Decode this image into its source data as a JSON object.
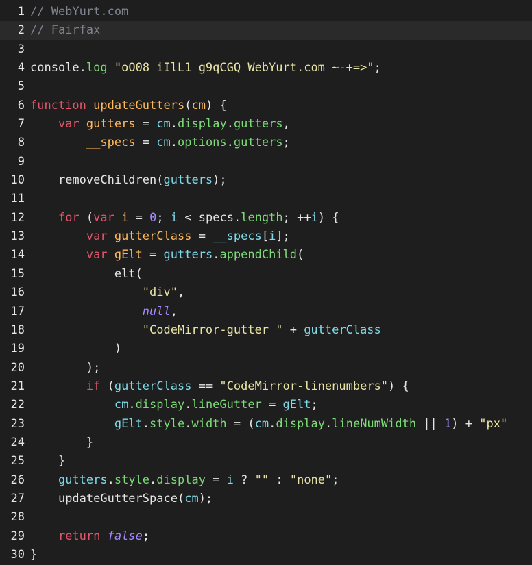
{
  "editor": {
    "highlighted_line": 2,
    "lines": [
      {
        "number": "1",
        "tokens": [
          {
            "t": "// WebYurt.com",
            "k": "comment"
          }
        ]
      },
      {
        "number": "2",
        "tokens": [
          {
            "t": "// Fairfax",
            "k": "comment"
          }
        ]
      },
      {
        "number": "3",
        "tokens": []
      },
      {
        "number": "4",
        "tokens": [
          {
            "t": "console",
            "k": "ident"
          },
          {
            "t": ".",
            "k": "punc"
          },
          {
            "t": "log",
            "k": "prop"
          },
          {
            "t": " ",
            "k": "punc"
          },
          {
            "t": "\"oO08 iIlL1 g9qCGQ WebYurt.com ~-+=>\"",
            "k": "string"
          },
          {
            "t": ";",
            "k": "punc"
          }
        ]
      },
      {
        "number": "5",
        "tokens": []
      },
      {
        "number": "6",
        "tokens": [
          {
            "t": "function",
            "k": "keyword"
          },
          {
            "t": " ",
            "k": "punc"
          },
          {
            "t": "updateGutters",
            "k": "def"
          },
          {
            "t": "(",
            "k": "punc"
          },
          {
            "t": "cm",
            "k": "def"
          },
          {
            "t": ") {",
            "k": "punc"
          }
        ]
      },
      {
        "number": "7",
        "tokens": [
          {
            "t": "    ",
            "k": "punc"
          },
          {
            "t": "var",
            "k": "keyword"
          },
          {
            "t": " ",
            "k": "punc"
          },
          {
            "t": "gutters",
            "k": "def"
          },
          {
            "t": " = ",
            "k": "op"
          },
          {
            "t": "cm",
            "k": "var"
          },
          {
            "t": ".",
            "k": "punc"
          },
          {
            "t": "display",
            "k": "prop"
          },
          {
            "t": ".",
            "k": "punc"
          },
          {
            "t": "gutters",
            "k": "prop"
          },
          {
            "t": ",",
            "k": "punc"
          }
        ]
      },
      {
        "number": "8",
        "tokens": [
          {
            "t": "        ",
            "k": "punc"
          },
          {
            "t": "__specs",
            "k": "def"
          },
          {
            "t": " = ",
            "k": "op"
          },
          {
            "t": "cm",
            "k": "var"
          },
          {
            "t": ".",
            "k": "punc"
          },
          {
            "t": "options",
            "k": "prop"
          },
          {
            "t": ".",
            "k": "punc"
          },
          {
            "t": "gutters",
            "k": "prop"
          },
          {
            "t": ";",
            "k": "punc"
          }
        ]
      },
      {
        "number": "9",
        "tokens": []
      },
      {
        "number": "10",
        "tokens": [
          {
            "t": "    ",
            "k": "punc"
          },
          {
            "t": "removeChildren",
            "k": "ident"
          },
          {
            "t": "(",
            "k": "punc"
          },
          {
            "t": "gutters",
            "k": "var"
          },
          {
            "t": ");",
            "k": "punc"
          }
        ]
      },
      {
        "number": "11",
        "tokens": []
      },
      {
        "number": "12",
        "tokens": [
          {
            "t": "    ",
            "k": "punc"
          },
          {
            "t": "for",
            "k": "keyword"
          },
          {
            "t": " (",
            "k": "punc"
          },
          {
            "t": "var",
            "k": "keyword"
          },
          {
            "t": " ",
            "k": "punc"
          },
          {
            "t": "i",
            "k": "def"
          },
          {
            "t": " = ",
            "k": "op"
          },
          {
            "t": "0",
            "k": "number"
          },
          {
            "t": "; ",
            "k": "punc"
          },
          {
            "t": "i",
            "k": "var"
          },
          {
            "t": " < ",
            "k": "op"
          },
          {
            "t": "specs",
            "k": "ident"
          },
          {
            "t": ".",
            "k": "punc"
          },
          {
            "t": "length",
            "k": "prop"
          },
          {
            "t": "; ",
            "k": "punc"
          },
          {
            "t": "++",
            "k": "op"
          },
          {
            "t": "i",
            "k": "var"
          },
          {
            "t": ") {",
            "k": "punc"
          }
        ]
      },
      {
        "number": "13",
        "tokens": [
          {
            "t": "        ",
            "k": "punc"
          },
          {
            "t": "var",
            "k": "keyword"
          },
          {
            "t": " ",
            "k": "punc"
          },
          {
            "t": "gutterClass",
            "k": "def"
          },
          {
            "t": " = ",
            "k": "op"
          },
          {
            "t": "__specs",
            "k": "var"
          },
          {
            "t": "[",
            "k": "punc"
          },
          {
            "t": "i",
            "k": "var"
          },
          {
            "t": "];",
            "k": "punc"
          }
        ]
      },
      {
        "number": "14",
        "tokens": [
          {
            "t": "        ",
            "k": "punc"
          },
          {
            "t": "var",
            "k": "keyword"
          },
          {
            "t": " ",
            "k": "punc"
          },
          {
            "t": "gElt",
            "k": "def"
          },
          {
            "t": " = ",
            "k": "op"
          },
          {
            "t": "gutters",
            "k": "var"
          },
          {
            "t": ".",
            "k": "punc"
          },
          {
            "t": "appendChild",
            "k": "prop"
          },
          {
            "t": "(",
            "k": "punc"
          }
        ]
      },
      {
        "number": "15",
        "tokens": [
          {
            "t": "            ",
            "k": "punc"
          },
          {
            "t": "elt",
            "k": "ident"
          },
          {
            "t": "(",
            "k": "punc"
          }
        ]
      },
      {
        "number": "16",
        "tokens": [
          {
            "t": "                ",
            "k": "punc"
          },
          {
            "t": "\"div\"",
            "k": "string"
          },
          {
            "t": ",",
            "k": "punc"
          }
        ]
      },
      {
        "number": "17",
        "tokens": [
          {
            "t": "                ",
            "k": "punc"
          },
          {
            "t": "null",
            "k": "atom"
          },
          {
            "t": ",",
            "k": "punc"
          }
        ]
      },
      {
        "number": "18",
        "tokens": [
          {
            "t": "                ",
            "k": "punc"
          },
          {
            "t": "\"CodeMirror-gutter \"",
            "k": "string"
          },
          {
            "t": " + ",
            "k": "op"
          },
          {
            "t": "gutterClass",
            "k": "var"
          }
        ]
      },
      {
        "number": "19",
        "tokens": [
          {
            "t": "            ",
            "k": "punc"
          },
          {
            "t": ")",
            "k": "punc"
          }
        ]
      },
      {
        "number": "20",
        "tokens": [
          {
            "t": "        ",
            "k": "punc"
          },
          {
            "t": ");",
            "k": "punc"
          }
        ]
      },
      {
        "number": "21",
        "tokens": [
          {
            "t": "        ",
            "k": "punc"
          },
          {
            "t": "if",
            "k": "keyword"
          },
          {
            "t": " (",
            "k": "punc"
          },
          {
            "t": "gutterClass",
            "k": "var"
          },
          {
            "t": " == ",
            "k": "op"
          },
          {
            "t": "\"CodeMirror-linenumbers\"",
            "k": "string"
          },
          {
            "t": ") {",
            "k": "punc"
          }
        ]
      },
      {
        "number": "22",
        "tokens": [
          {
            "t": "            ",
            "k": "punc"
          },
          {
            "t": "cm",
            "k": "var"
          },
          {
            "t": ".",
            "k": "punc"
          },
          {
            "t": "display",
            "k": "prop"
          },
          {
            "t": ".",
            "k": "punc"
          },
          {
            "t": "lineGutter",
            "k": "prop"
          },
          {
            "t": " = ",
            "k": "op"
          },
          {
            "t": "gElt",
            "k": "var"
          },
          {
            "t": ";",
            "k": "punc"
          }
        ]
      },
      {
        "number": "23",
        "tokens": [
          {
            "t": "            ",
            "k": "punc"
          },
          {
            "t": "gElt",
            "k": "var"
          },
          {
            "t": ".",
            "k": "punc"
          },
          {
            "t": "style",
            "k": "prop"
          },
          {
            "t": ".",
            "k": "punc"
          },
          {
            "t": "width",
            "k": "prop"
          },
          {
            "t": " = (",
            "k": "op"
          },
          {
            "t": "cm",
            "k": "var"
          },
          {
            "t": ".",
            "k": "punc"
          },
          {
            "t": "display",
            "k": "prop"
          },
          {
            "t": ".",
            "k": "punc"
          },
          {
            "t": "lineNumWidth",
            "k": "prop"
          },
          {
            "t": " || ",
            "k": "op"
          },
          {
            "t": "1",
            "k": "number"
          },
          {
            "t": ") + ",
            "k": "op"
          },
          {
            "t": "\"px\"",
            "k": "string"
          }
        ]
      },
      {
        "number": "24",
        "tokens": [
          {
            "t": "        ",
            "k": "punc"
          },
          {
            "t": "}",
            "k": "punc"
          }
        ]
      },
      {
        "number": "25",
        "tokens": [
          {
            "t": "    ",
            "k": "punc"
          },
          {
            "t": "}",
            "k": "punc"
          }
        ]
      },
      {
        "number": "26",
        "tokens": [
          {
            "t": "    ",
            "k": "punc"
          },
          {
            "t": "gutters",
            "k": "var"
          },
          {
            "t": ".",
            "k": "punc"
          },
          {
            "t": "style",
            "k": "prop"
          },
          {
            "t": ".",
            "k": "punc"
          },
          {
            "t": "display",
            "k": "prop"
          },
          {
            "t": " = ",
            "k": "op"
          },
          {
            "t": "i",
            "k": "var"
          },
          {
            "t": " ? ",
            "k": "op"
          },
          {
            "t": "\"\"",
            "k": "string"
          },
          {
            "t": " : ",
            "k": "op"
          },
          {
            "t": "\"none\"",
            "k": "string"
          },
          {
            "t": ";",
            "k": "punc"
          }
        ]
      },
      {
        "number": "27",
        "tokens": [
          {
            "t": "    ",
            "k": "punc"
          },
          {
            "t": "updateGutterSpace",
            "k": "ident"
          },
          {
            "t": "(",
            "k": "punc"
          },
          {
            "t": "cm",
            "k": "var"
          },
          {
            "t": ");",
            "k": "punc"
          }
        ]
      },
      {
        "number": "28",
        "tokens": []
      },
      {
        "number": "29",
        "tokens": [
          {
            "t": "    ",
            "k": "punc"
          },
          {
            "t": "return",
            "k": "keyword"
          },
          {
            "t": " ",
            "k": "punc"
          },
          {
            "t": "false",
            "k": "atom"
          },
          {
            "t": ";",
            "k": "punc"
          }
        ]
      },
      {
        "number": "30",
        "tokens": [
          {
            "t": "}",
            "k": "punc"
          }
        ]
      }
    ]
  },
  "colors": {
    "background": "#1e1e1e",
    "current_line": "#2a2a2a",
    "keyword": "#e2566a",
    "string": "#e9e4a4",
    "property": "#7ddb78",
    "variable": "#7fd9e8",
    "definition": "#ffb85a",
    "number": "#a787ff",
    "comment": "#7f848e"
  }
}
